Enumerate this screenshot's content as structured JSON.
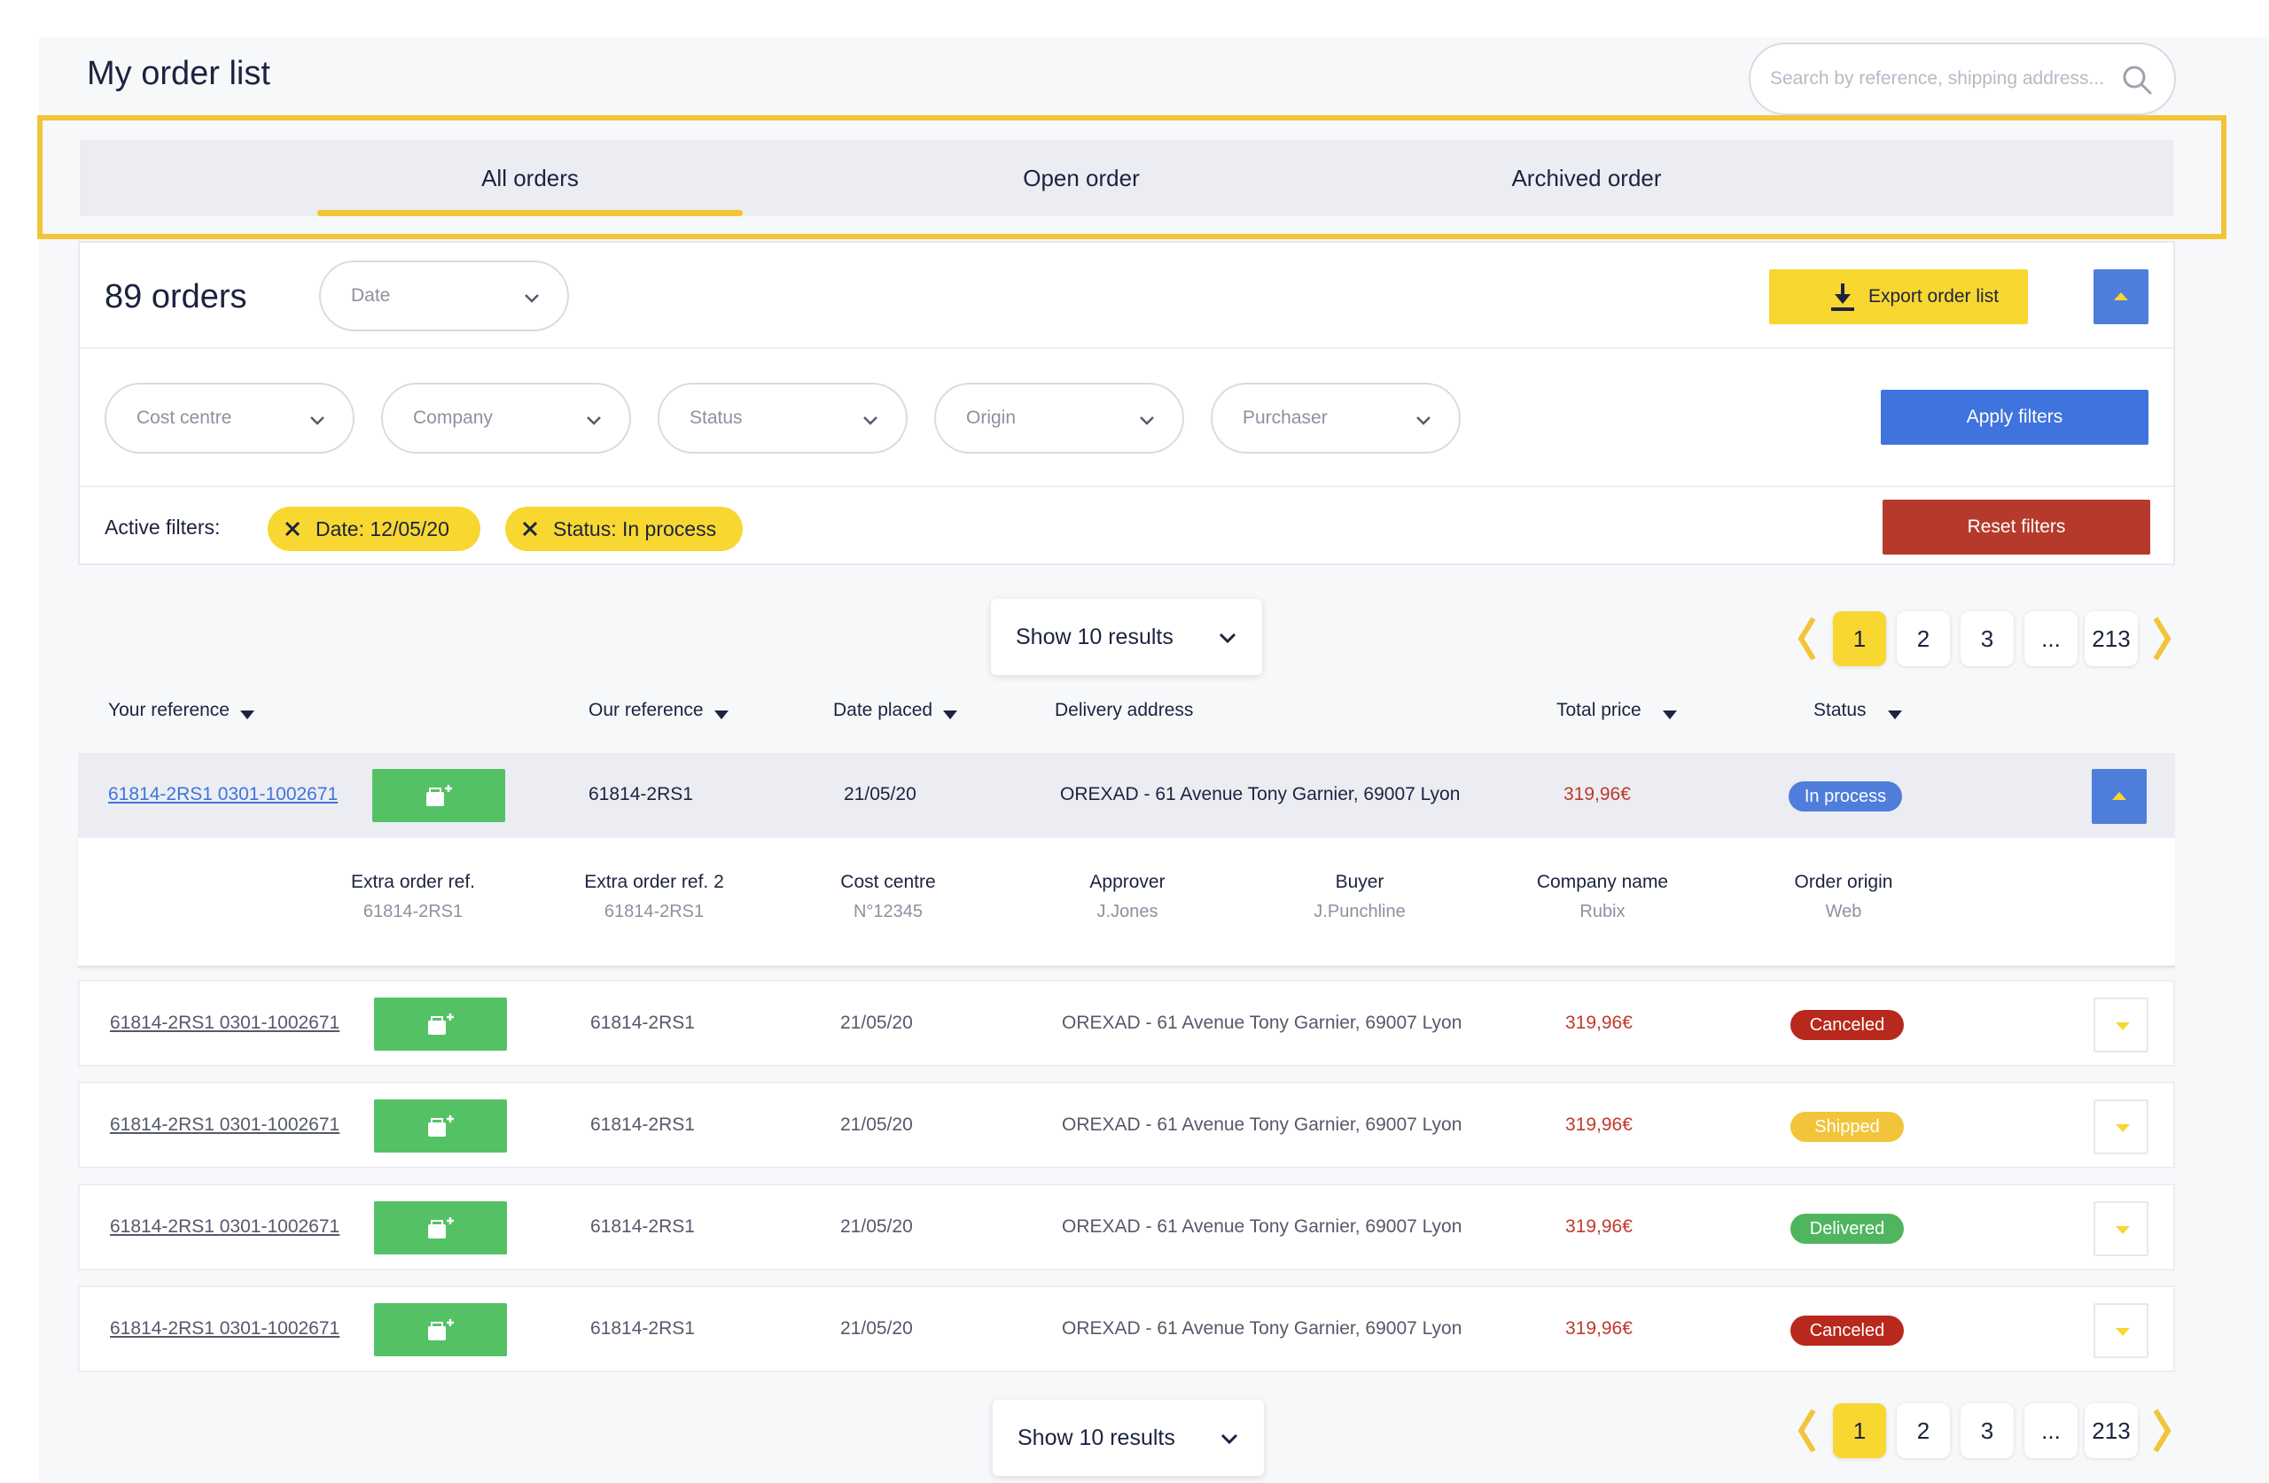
{
  "page": {
    "title": "My order list",
    "search_placeholder": "Search by reference, shipping address..."
  },
  "tabs": [
    {
      "label": "All orders",
      "active": true
    },
    {
      "label": "Open order",
      "active": false
    },
    {
      "label": "Archived order",
      "active": false
    }
  ],
  "filters": {
    "orders_count": "89 orders",
    "date_dropdown": "Date",
    "export_label": "Export order list",
    "dropdowns": [
      "Cost centre",
      "Company",
      "Status",
      "Origin",
      "Purchaser"
    ],
    "apply_label": "Apply filters",
    "active_filters_label": "Active filters:",
    "chips": [
      "Date: 12/05/20",
      "Status: In process"
    ],
    "reset_label": "Reset filters"
  },
  "results": {
    "show_label": "Show 10 results",
    "pages": [
      "1",
      "2",
      "3",
      "...",
      "213"
    ],
    "active_page": "1"
  },
  "table": {
    "headers": {
      "your_reference": "Your reference",
      "our_reference": "Our reference",
      "date_placed": "Date placed",
      "delivery_address": "Delivery address",
      "total_price": "Total price",
      "status": "Status"
    },
    "rows": [
      {
        "your_ref": "61814-2RS1 0301-1002671",
        "our_ref": "61814-2RS1",
        "date": "21/05/20",
        "address": "OREXAD - 61 Avenue Tony Garnier, 69007 Lyon",
        "price": "319,96€",
        "status": "In process",
        "status_color": "#4f7ddb",
        "expanded": true
      },
      {
        "your_ref": "61814-2RS1 0301-1002671",
        "our_ref": "61814-2RS1",
        "date": "21/05/20",
        "address": "OREXAD - 61 Avenue Tony Garnier, 69007 Lyon",
        "price": "319,96€",
        "status": "Canceled",
        "status_color": "#b8281c",
        "expanded": false
      },
      {
        "your_ref": "61814-2RS1 0301-1002671",
        "our_ref": "61814-2RS1",
        "date": "21/05/20",
        "address": "OREXAD - 61 Avenue Tony Garnier, 69007 Lyon",
        "price": "319,96€",
        "status": "Shipped",
        "status_color": "#f2c43a",
        "expanded": false
      },
      {
        "your_ref": "61814-2RS1 0301-1002671",
        "our_ref": "61814-2RS1",
        "date": "21/05/20",
        "address": "OREXAD - 61 Avenue Tony Garnier, 69007 Lyon",
        "price": "319,96€",
        "status": "Delivered",
        "status_color": "#4fb55e",
        "expanded": false
      },
      {
        "your_ref": "61814-2RS1 0301-1002671",
        "our_ref": "61814-2RS1",
        "date": "21/05/20",
        "address": "OREXAD - 61 Avenue Tony Garnier, 69007 Lyon",
        "price": "319,96€",
        "status": "Canceled",
        "status_color": "#b8281c",
        "expanded": false
      }
    ],
    "details": [
      {
        "label": "Extra order ref.",
        "value": "61814-2RS1"
      },
      {
        "label": "Extra order ref. 2",
        "value": "61814-2RS1"
      },
      {
        "label": "Cost centre",
        "value": "N°12345"
      },
      {
        "label": "Approver",
        "value": "J.Jones"
      },
      {
        "label": "Buyer",
        "value": "J.Punchline"
      },
      {
        "label": "Company name",
        "value": "Rubix"
      },
      {
        "label": "Order origin",
        "value": "Web"
      }
    ]
  },
  "colors": {
    "accent_yellow": "#f8d730",
    "primary_blue": "#3f73dd",
    "danger_red": "#b53a2b",
    "success_green": "#54c165"
  }
}
